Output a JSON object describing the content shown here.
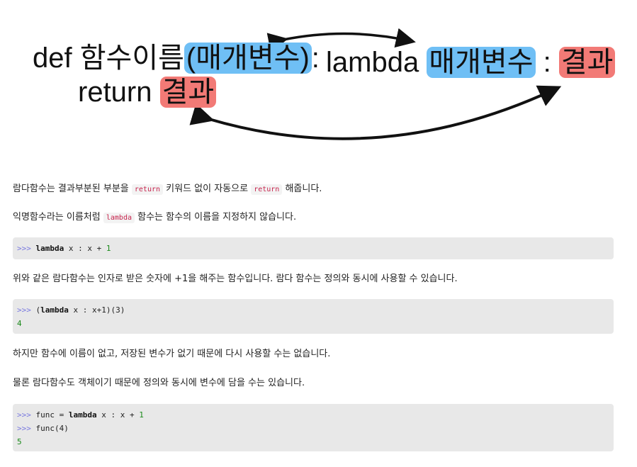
{
  "diagram": {
    "def_kw": "def ",
    "func_name": "함수이름",
    "params_paren": "(매개변수)",
    "colon": ":",
    "return_kw": "return ",
    "result": "결과",
    "lambda_kw": "lambda ",
    "lambda_params": "매개변수",
    "lambda_colon": " : ",
    "lambda_result": "결과",
    "colors": {
      "param_highlight": "#6fbff5",
      "result_highlight": "#f27a76"
    }
  },
  "paragraphs": {
    "p1_a": "람다함수는 결과부분된 부분을 ",
    "p1_code": "return",
    "p1_b": " 키워드 없이 자동으로 ",
    "p1_code2": "return",
    "p1_c": " 해줍니다.",
    "p2_a": "익명함수라는 이름처럼 ",
    "p2_code": "lambda",
    "p2_b": " 함수는 함수의 이름을 지정하지 않습니다.",
    "p3": "위와 같은 람다함수는 인자로 받은 숫자에 +1을 해주는 함수입니다. 람다 함수는 정의와 동시에 사용할 수 있습니다.",
    "p4": "하지만 함수에 이름이 없고, 저장된 변수가 없기 때문에 다시 사용할 수는 없습니다.",
    "p5": "물론 람다함수도 객체이기 때문에 정의와 동시에 변수에 담을 수는 있습니다."
  },
  "code": {
    "prompt": ">>>",
    "b1_l1_kw": "lambda",
    "b1_l1_rest": " x : x + ",
    "b1_l1_num": "1",
    "b2_l1_open": " (",
    "b2_l1_kw": "lambda",
    "b2_l1_rest": " x : x+1)(3)",
    "b2_out": "4",
    "b3_l1_a": " func = ",
    "b3_l1_kw": "lambda",
    "b3_l1_rest": " x : x + ",
    "b3_l1_num": "1",
    "b3_l2": " func(4)",
    "b3_out": "5"
  }
}
